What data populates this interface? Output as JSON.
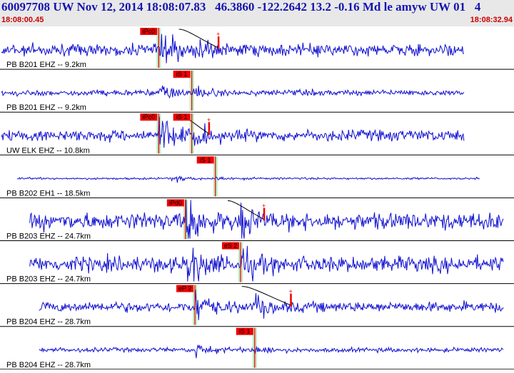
{
  "header": {
    "title": "60097708 UW Nov 12, 2014 18:08:07.83   46.3860 -122.2642 13.2 -0.16 Md le amyw UW 01   4",
    "start_time": "18:08:00.45",
    "end_time": "18:08:32.94"
  },
  "colors": {
    "trace": "#1010d0",
    "pick": "#ee0000",
    "window": "#bfe8bf",
    "divider": "#000000",
    "header_bg": "#e8e8e8",
    "title_text": "#1515b0",
    "time_text": "#cc0000"
  },
  "traces": [
    {
      "label": "PB B201 EHZ -- 9.2km",
      "picks": [
        "iPc0"
      ],
      "amplitude": 0.35,
      "trace_start_s": 0.0,
      "trace_end_s": 29.4,
      "p_time_s": 10.0,
      "s_time_s": 12.1,
      "event_pulse": true,
      "mark_p": true,
      "mark_s": false,
      "coda_end_s": 13.8
    },
    {
      "label": "PB B201 EHZ -- 9.2km",
      "picks": [
        "iS 1"
      ],
      "amplitude": 0.17,
      "trace_start_s": 0.0,
      "trace_end_s": 29.4,
      "p_time_s": 10.0,
      "s_time_s": 12.1,
      "event_pulse": false,
      "mark_p": false,
      "mark_s": true
    },
    {
      "label": "UW ELK EHZ -- 10.8km",
      "picks": [
        "iPc0",
        "iS 1"
      ],
      "amplitude": 0.33,
      "trace_start_s": 0.0,
      "trace_end_s": 29.4,
      "p_time_s": 10.0,
      "s_time_s": 12.1,
      "event_pulse": true,
      "mark_p": true,
      "mark_s": true,
      "coda_end_s": 13.2
    },
    {
      "label": "PB B202 EH1 -- 18.5km",
      "picks": [
        "iS 1"
      ],
      "amplitude": 0.06,
      "trace_start_s": 1.0,
      "trace_end_s": 30.4,
      "p_time_s": 10.8,
      "s_time_s": 13.6,
      "event_pulse": false,
      "mark_p": false,
      "mark_s": true
    },
    {
      "label": "PB B203 EHZ -- 24.7km",
      "picks": [
        "iPd0"
      ],
      "amplitude": 0.5,
      "trace_start_s": 1.8,
      "trace_end_s": 31.9,
      "p_time_s": 11.7,
      "s_time_s": 15.2,
      "event_pulse": true,
      "mark_p": true,
      "mark_s": false,
      "coda_end_s": 16.7
    },
    {
      "label": "PB B203 EHZ -- 24.7km",
      "picks": [
        "eS 2"
      ],
      "amplitude": 0.45,
      "trace_start_s": 1.8,
      "trace_end_s": 31.9,
      "p_time_s": 11.7,
      "s_time_s": 15.2,
      "event_pulse": false,
      "mark_p": false,
      "mark_s": true
    },
    {
      "label": "PB B204 EHZ -- 28.7km",
      "picks": [
        "eP 2"
      ],
      "amplitude": 0.3,
      "trace_start_s": 2.4,
      "trace_end_s": 31.9,
      "p_time_s": 12.3,
      "s_time_s": 16.1,
      "event_pulse": true,
      "mark_p": true,
      "mark_s": false,
      "coda_end_s": 18.4
    },
    {
      "label": "PB B204 EHZ -- 28.7km",
      "picks": [
        "iS 1"
      ],
      "amplitude": 0.13,
      "trace_start_s": 2.4,
      "trace_end_s": 31.9,
      "p_time_s": 12.3,
      "s_time_s": 16.1,
      "event_pulse": false,
      "mark_p": false,
      "mark_s": true
    }
  ]
}
